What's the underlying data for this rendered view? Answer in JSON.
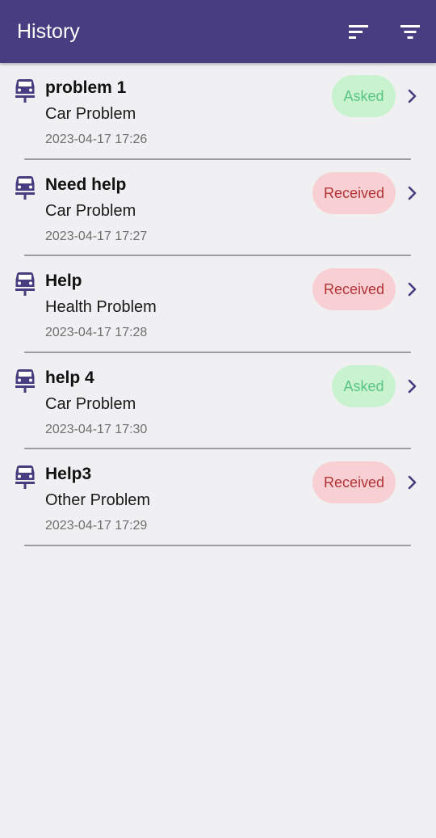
{
  "appbar": {
    "title": "History",
    "sort_icon": "sort-icon",
    "filter_icon": "filter-icon",
    "background": "#483d80"
  },
  "items": [
    {
      "title": "problem 1",
      "category": "Car Problem",
      "date": "2023-04-17 17:26",
      "status": "Asked",
      "status_type": "asked",
      "icon": "car-icon"
    },
    {
      "title": "Need help",
      "category": "Car Problem",
      "date": "2023-04-17 17:27",
      "status": "Received",
      "status_type": "received",
      "icon": "car-icon"
    },
    {
      "title": "Help",
      "category": "Health Problem",
      "date": "2023-04-17 17:28",
      "status": "Received",
      "status_type": "received",
      "icon": "car-icon"
    },
    {
      "title": "help 4",
      "category": "Car Problem",
      "date": "2023-04-17 17:30",
      "status": "Asked",
      "status_type": "asked",
      "icon": "car-icon"
    },
    {
      "title": "Help3",
      "category": "Other Problem",
      "date": "2023-04-17 17:29",
      "status": "Received",
      "status_type": "received",
      "icon": "car-icon"
    }
  ],
  "colors": {
    "accent": "#483d80",
    "asked_bg": "#c9f2cf",
    "asked_text": "#59c583",
    "received_bg": "#f8d0d3",
    "received_text": "#b23236",
    "background": "#f0f0f2"
  }
}
